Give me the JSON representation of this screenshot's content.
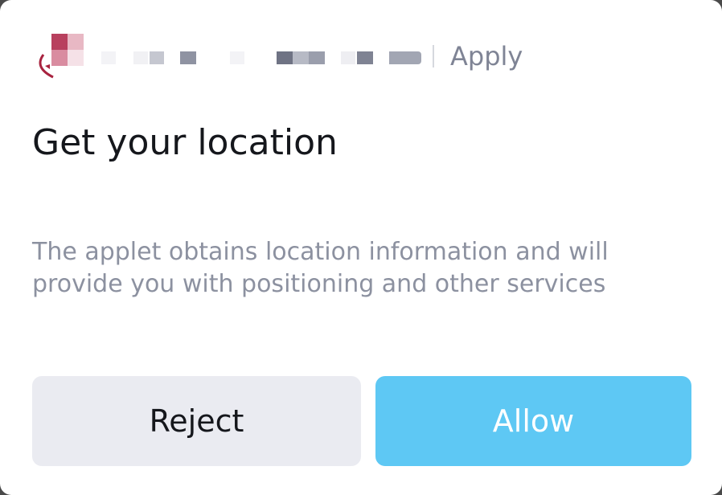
{
  "header": {
    "logo_icon": "app-logo-icon",
    "app_name_redacted": true,
    "apply_label": "Apply"
  },
  "dialog": {
    "title": "Get your location",
    "description": "The applet obtains location information and will provide you with positioning and other services"
  },
  "actions": {
    "reject_label": "Reject",
    "allow_label": "Allow"
  },
  "colors": {
    "allow_button": "#5ec8f4",
    "reject_button": "#eaebf1",
    "title_text": "#15171c",
    "description_text": "#8c91a0",
    "logo_accent": "#b8405e"
  }
}
